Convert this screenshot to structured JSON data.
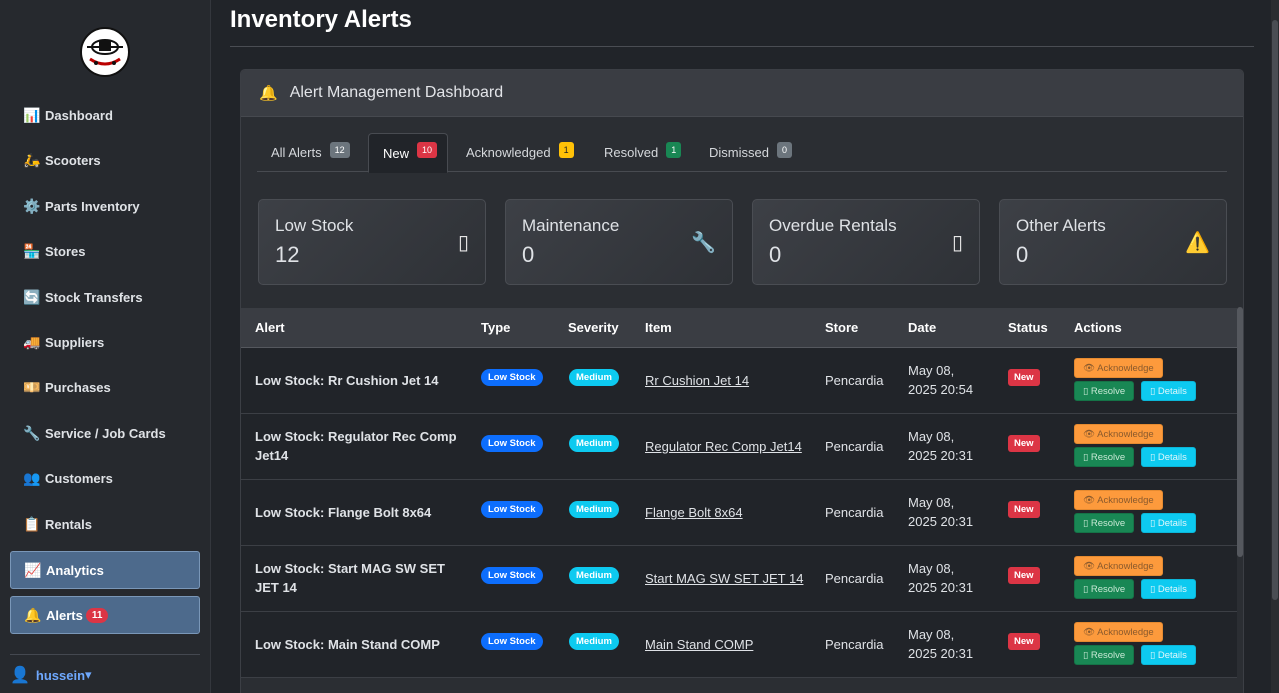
{
  "sidebar": {
    "items": [
      {
        "label": "Dashboard",
        "icon": "📊"
      },
      {
        "label": "Scooters",
        "icon": "🛵"
      },
      {
        "label": "Parts Inventory",
        "icon": "⚙️"
      },
      {
        "label": "Stores",
        "icon": "🏪"
      },
      {
        "label": "Stock Transfers",
        "icon": "🔄"
      },
      {
        "label": "Suppliers",
        "icon": "🚚"
      },
      {
        "label": "Purchases",
        "icon": "💴"
      },
      {
        "label": "Service / Job Cards",
        "icon": "🔧"
      },
      {
        "label": "Customers",
        "icon": "👥"
      },
      {
        "label": "Rentals",
        "icon": "📋"
      },
      {
        "label": "Analytics",
        "icon": "📈"
      },
      {
        "label": "Alerts",
        "icon": "🔔",
        "badge": "11"
      }
    ],
    "user": {
      "name": "hussein",
      "caret": "▾",
      "icon": "👤"
    }
  },
  "page": {
    "title": "Inventory Alerts"
  },
  "card": {
    "title": "Alert Management Dashboard",
    "icon": "🔔"
  },
  "tabs": [
    {
      "label": "All Alerts",
      "count": "12"
    },
    {
      "label": "New",
      "count": "10"
    },
    {
      "label": "Acknowledged",
      "count": "1"
    },
    {
      "label": "Resolved",
      "count": "1"
    },
    {
      "label": "Dismissed",
      "count": "0"
    }
  ],
  "stats": [
    {
      "label": "Low Stock",
      "value": "12",
      "icon": "▯"
    },
    {
      "label": "Maintenance",
      "value": "0",
      "icon": "🔧"
    },
    {
      "label": "Overdue Rentals",
      "value": "0",
      "icon": "▯"
    },
    {
      "label": "Other Alerts",
      "value": "0",
      "icon": "⚠️"
    }
  ],
  "table": {
    "headers": [
      "Alert",
      "Type",
      "Severity",
      "Item",
      "Store",
      "Date",
      "Status",
      "Actions"
    ],
    "actions": {
      "acknowledge": "👁 Acknowledge",
      "resolve": "▯ Resolve",
      "details": "▯ Details"
    },
    "rows": [
      {
        "alert": "Low Stock: Rr Cushion Jet 14",
        "type": "Low Stock",
        "severity": "Medium",
        "item": "Rr Cushion Jet 14",
        "store": "Pencardia",
        "date_line1": "May 08,",
        "date_line2": "2025 20:54",
        "status": "New"
      },
      {
        "alert": "Low Stock: Regulator Rec Comp Jet14",
        "type": "Low Stock",
        "severity": "Medium",
        "item": "Regulator Rec Comp Jet14",
        "store": "Pencardia",
        "date_line1": "May 08,",
        "date_line2": "2025 20:31",
        "status": "New"
      },
      {
        "alert": "Low Stock: Flange Bolt 8x64",
        "type": "Low Stock",
        "severity": "Medium",
        "item": "Flange Bolt 8x64",
        "store": "Pencardia",
        "date_line1": "May 08,",
        "date_line2": "2025 20:31",
        "status": "New"
      },
      {
        "alert": "Low Stock: Start MAG SW SET JET 14",
        "type": "Low Stock",
        "severity": "Medium",
        "item": "Start MAG SW SET JET 14",
        "store": "Pencardia",
        "date_line1": "May 08,",
        "date_line2": "2025 20:31",
        "status": "New"
      },
      {
        "alert": "Low Stock: Main Stand COMP",
        "type": "Low Stock",
        "severity": "Medium",
        "item": "Main Stand COMP",
        "store": "Pencardia",
        "date_line1": "May 08,",
        "date_line2": "2025 20:31",
        "status": "New"
      }
    ]
  }
}
